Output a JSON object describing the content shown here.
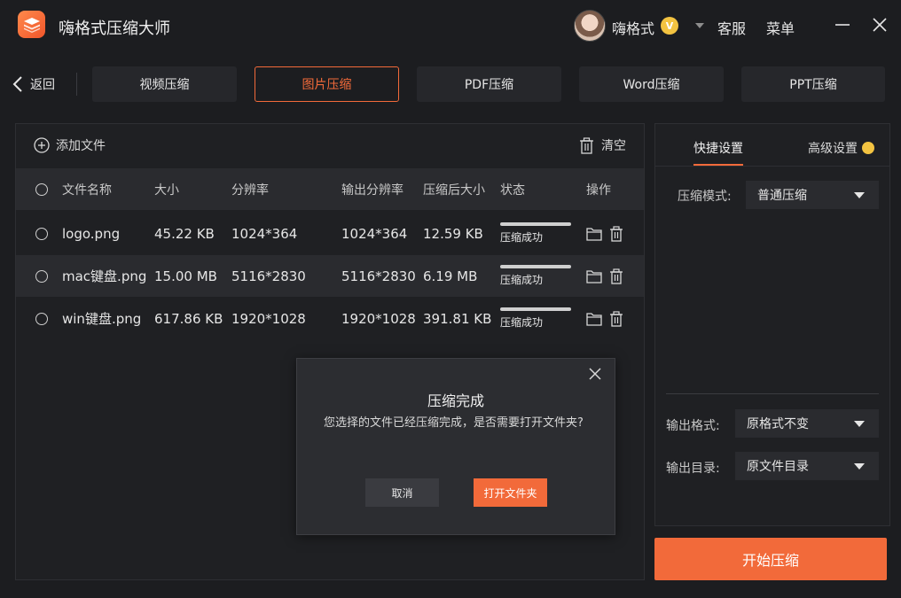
{
  "app": {
    "title": "嗨格式压缩大师"
  },
  "user": {
    "name": "嗨格式",
    "vip_symbol": "V"
  },
  "header": {
    "service": "客服",
    "menu": "菜单"
  },
  "nav": {
    "back": "返回",
    "tabs": [
      "视频压缩",
      "图片压缩",
      "PDF压缩",
      "Word压缩",
      "PPT压缩"
    ],
    "active_tab": "图片压缩"
  },
  "toolbar": {
    "add_file": "添加文件",
    "clear": "清空"
  },
  "table": {
    "headers": [
      "文件名称",
      "大小",
      "分辨率",
      "输出分辨率",
      "压缩后大小",
      "状态",
      "操作"
    ],
    "rows": [
      {
        "name": "logo.png",
        "size": "45.22 KB",
        "resolution": "1024*364",
        "output_resolution": "1024*364",
        "compressed_size": "12.59 KB",
        "status": "压缩成功",
        "progress": 1.0
      },
      {
        "name": "mac键盘.png",
        "size": "15.00 MB",
        "resolution": "5116*2830",
        "output_resolution": "5116*2830",
        "compressed_size": "6.19 MB",
        "status": "压缩成功",
        "progress": 1.0
      },
      {
        "name": "win键盘.png",
        "size": "617.86 KB",
        "resolution": "1920*1028",
        "output_resolution": "1920*1028",
        "compressed_size": "391.81 KB",
        "status": "压缩成功",
        "progress": 1.0
      }
    ]
  },
  "dialog": {
    "title": "压缩完成",
    "message": "您选择的文件已经压缩完成，是否需要打开文件夹?",
    "cancel": "取消",
    "confirm": "打开文件夹"
  },
  "settings": {
    "tabs": {
      "quick": "快捷设置",
      "advanced": "高级设置"
    },
    "mode_label": "压缩模式:",
    "mode_value": "普通压缩",
    "format_label": "输出格式:",
    "format_value": "原格式不变",
    "dir_label": "输出目录:",
    "dir_value": "原文件目录"
  },
  "start_button": "开始压缩",
  "colors": {
    "accent": "#f26a3a",
    "background": "#1c1d20",
    "panel": "#1f2023",
    "vip": "#f3c341"
  }
}
